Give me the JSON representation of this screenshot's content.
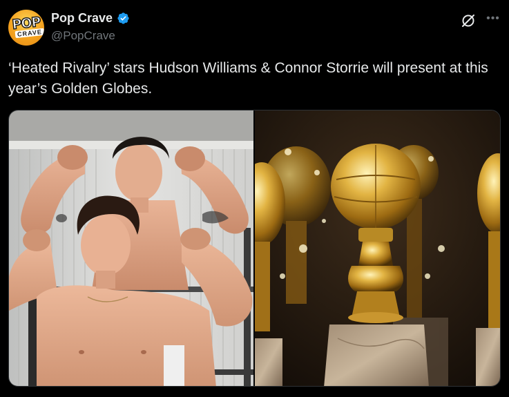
{
  "account": {
    "display_name": "Pop Crave",
    "handle": "@PopCrave",
    "avatar_text_top": "POP",
    "avatar_text_bottom": "CRAVE",
    "verified_icon": "verified-badge-icon",
    "verified_color": "#1d9bf0"
  },
  "header_actions": {
    "grok_icon": "grok-icon",
    "more_icon": "more-options-icon"
  },
  "tweet": {
    "text": "‘Heated Rivalry’ stars Hudson Williams & Connor Storrie will present at this year’s Golden Globes."
  },
  "media": {
    "left_image": "photo-of-two-shirtless-men-flexing",
    "right_image": "photo-of-golden-globe-trophies"
  },
  "colors": {
    "background": "#000000",
    "text_primary": "#e7e9ea",
    "text_secondary": "#71767b",
    "accent_blue": "#1d9bf0",
    "gold": "#d4a32a"
  }
}
